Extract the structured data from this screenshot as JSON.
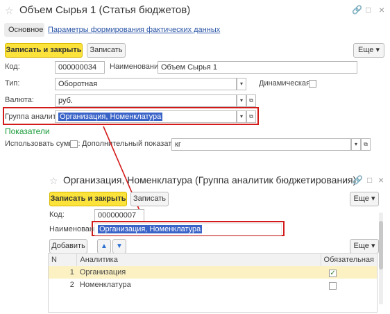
{
  "main": {
    "title": "Объем Сырья 1 (Статья бюджетов)",
    "tabs": [
      "Основное",
      "Параметры формирования фактических данных"
    ],
    "buttons": {
      "save_close": "Записать и закрыть",
      "save": "Записать",
      "more": "Еще ▾"
    },
    "fields": {
      "code_label": "Код:",
      "code_value": "000000034",
      "name_label": "Наименование:",
      "name_value": "Объем Сырья 1",
      "type_label": "Тип:",
      "type_value": "Оборотная",
      "dynamic_label": "Динамическая:",
      "currency_label": "Валюта:",
      "currency_value": "руб.",
      "group_label": "Группа аналитик:",
      "group_value": "Организация, Номенклатура"
    },
    "section_title": "Показатели",
    "use_sum_label": "Использовать сумму:",
    "extra_label": "Дополнительный показатель:",
    "extra_value": "кг"
  },
  "dialog": {
    "title": "Организация, Номенклатура (Группа аналитик бюджетирования)",
    "buttons": {
      "save_close": "Записать и закрыть",
      "save": "Записать",
      "more": "Еще ▾",
      "add": "Добавить",
      "more2": "Еще ▾"
    },
    "code_label": "Код:",
    "code_value": "000000007",
    "name_label": "Наименование:",
    "name_value": "Организация, Номенклатура",
    "table": {
      "headers": [
        "N",
        "Аналитика",
        "Обязательная"
      ],
      "rows": [
        {
          "n": "1",
          "name": "Организация",
          "required": true
        },
        {
          "n": "2",
          "name": "Номенклатура",
          "required": false
        }
      ]
    }
  },
  "icons": {
    "star": "☆",
    "link": "🔗",
    "max": "□",
    "close": "×",
    "up": "🡅",
    "down": "🡇"
  }
}
